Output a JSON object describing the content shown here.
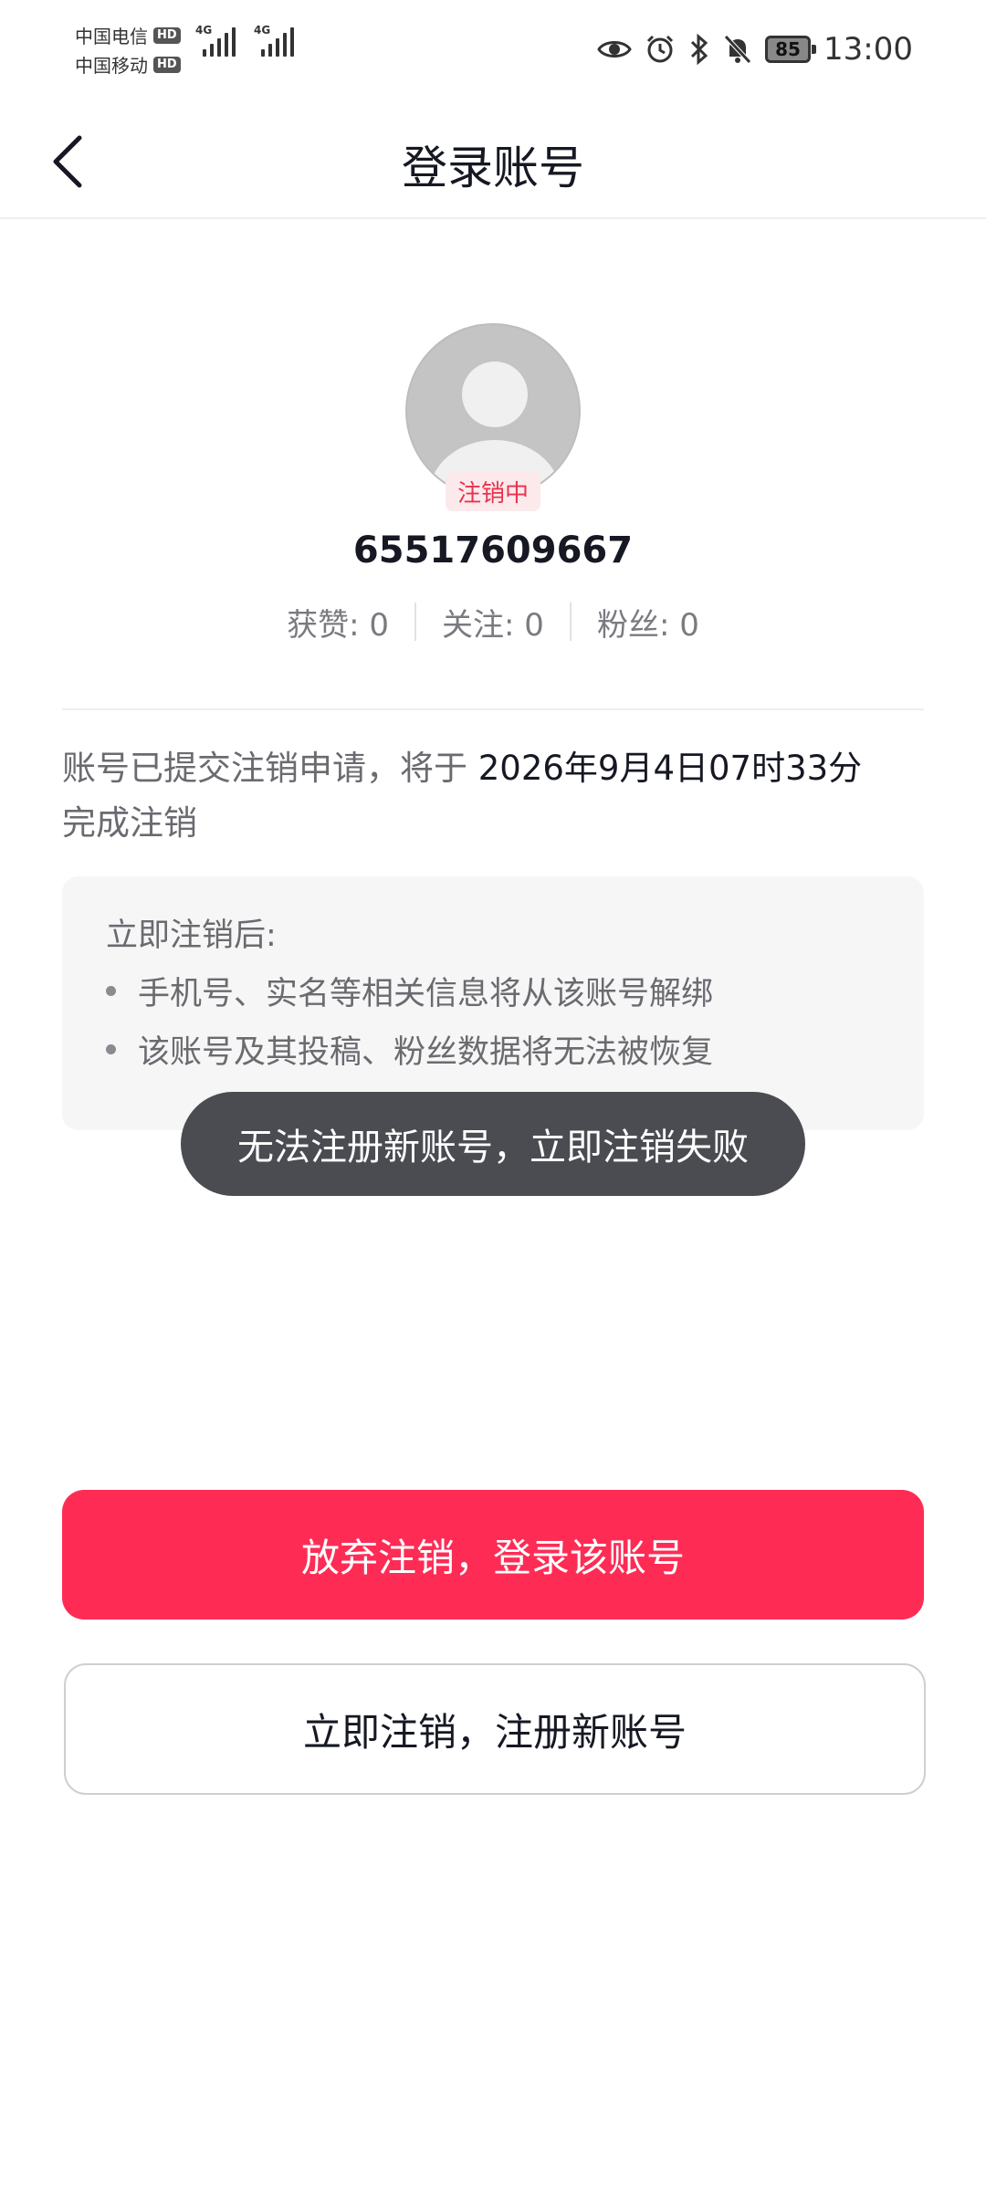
{
  "status_bar": {
    "carrier1": "中国电信",
    "carrier2": "中国移动",
    "hd": "HD",
    "network1": "4G",
    "network2": "4G",
    "battery": "85",
    "time": "13:00",
    "icons": [
      "eye-icon",
      "alarm-icon",
      "bluetooth-icon",
      "mute-bell-icon"
    ]
  },
  "nav": {
    "title": "登录账号",
    "back_icon": "chevron-left-icon"
  },
  "profile": {
    "badge": "注销中",
    "user_id": "65517609667",
    "stats": [
      {
        "label": "获赞: 0"
      },
      {
        "label": "关注: 0"
      },
      {
        "label": "粉丝: 0"
      }
    ]
  },
  "notice": {
    "prefix": "账号已提交注销申请，将于 ",
    "date": "2026年9月4日07时33分",
    "suffix": "完成注销"
  },
  "info": {
    "title": "立即注销后:",
    "items": [
      "手机号、实名等相关信息将从该账号解绑",
      "该账号及其投稿、粉丝数据将无法被恢复"
    ]
  },
  "toast": {
    "text": "无法注册新账号，立即注销失败"
  },
  "buttons": {
    "primary": "放弃注销，登录该账号",
    "secondary": "立即注销，注册新账号"
  },
  "colors": {
    "accent": "#fe2c55",
    "badge_text": "#e8334f",
    "toast_bg": "#4a4c52"
  }
}
